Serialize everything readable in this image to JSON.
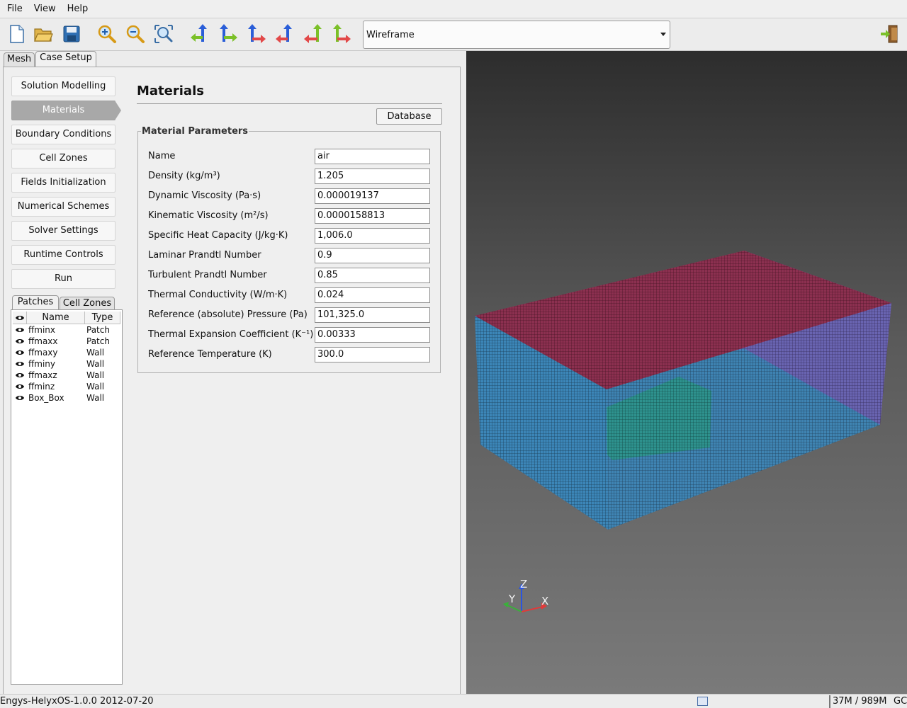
{
  "menu": [
    "File",
    "View",
    "Help"
  ],
  "toolbar": {
    "buttons": [
      {
        "name": "new-file-icon"
      },
      {
        "name": "open-folder-icon"
      },
      {
        "name": "save-icon"
      },
      {
        "name": "zoom-in-icon"
      },
      {
        "name": "zoom-out-icon"
      },
      {
        "name": "zoom-fit-icon"
      },
      {
        "name": "view-axis-1-icon"
      },
      {
        "name": "view-axis-2-icon"
      },
      {
        "name": "view-axis-3-icon"
      },
      {
        "name": "view-axis-4-icon"
      },
      {
        "name": "view-axis-5-icon"
      },
      {
        "name": "view-axis-6-icon"
      }
    ],
    "view_mode": "Wireframe",
    "exit_icon": "exit-door-icon"
  },
  "tabs": {
    "mesh": "Mesh",
    "case_setup": "Case Setup",
    "active": "Case Setup"
  },
  "nav": {
    "items": [
      "Solution Modelling",
      "Materials",
      "Boundary Conditions",
      "Cell Zones",
      "Fields Initialization",
      "Numerical Schemes",
      "Solver Settings",
      "Runtime Controls",
      "Run"
    ],
    "active": "Materials"
  },
  "sub_tabs": {
    "patches": "Patches",
    "cell_zones": "Cell Zones",
    "active": "Patches"
  },
  "patch_table": {
    "headers": {
      "name": "Name",
      "type": "Type"
    },
    "rows": [
      {
        "name": "ffminx",
        "type": "Patch"
      },
      {
        "name": "ffmaxx",
        "type": "Patch"
      },
      {
        "name": "ffmaxy",
        "type": "Wall"
      },
      {
        "name": "ffminy",
        "type": "Wall"
      },
      {
        "name": "ffmaxz",
        "type": "Wall"
      },
      {
        "name": "ffminz",
        "type": "Wall"
      },
      {
        "name": "Box_Box",
        "type": "Wall"
      }
    ]
  },
  "materials": {
    "title": "Materials",
    "database_button": "Database",
    "group_title": "Material Parameters",
    "params": [
      {
        "label": "Name",
        "value": "air"
      },
      {
        "label": "Density (kg/m³)",
        "value": "1.205"
      },
      {
        "label": "Dynamic Viscosity (Pa·s)",
        "value": "0.000019137"
      },
      {
        "label": "Kinematic Viscosity (m²/s)",
        "value": "0.0000158813"
      },
      {
        "label": "Specific Heat Capacity (J/kg·K)",
        "value": "1,006.0"
      },
      {
        "label": "Laminar Prandtl Number",
        "value": "0.9"
      },
      {
        "label": "Turbulent Prandtl Number",
        "value": "0.85"
      },
      {
        "label": "Thermal Conductivity (W/m·K)",
        "value": "0.024"
      },
      {
        "label": "Reference (absolute) Pressure (Pa)",
        "value": "101,325.0"
      },
      {
        "label": "Thermal Expansion Coefficient (K⁻¹)",
        "value": "0.00333"
      },
      {
        "label": "Reference Temperature (K)",
        "value": "300.0"
      }
    ]
  },
  "viewport": {
    "axes": {
      "x": "X",
      "y": "Y",
      "z": "Z"
    },
    "colors": {
      "top": "#8a2a4a",
      "side_right": "#9a2a9a",
      "mesh_blue": "#3a8ac0",
      "inner_box": "#1a9a4a"
    }
  },
  "status": {
    "version": "Engys-HelyxOS-1.0.0 2012-07-20",
    "memory": "37M / 989M",
    "gc": "GC"
  }
}
